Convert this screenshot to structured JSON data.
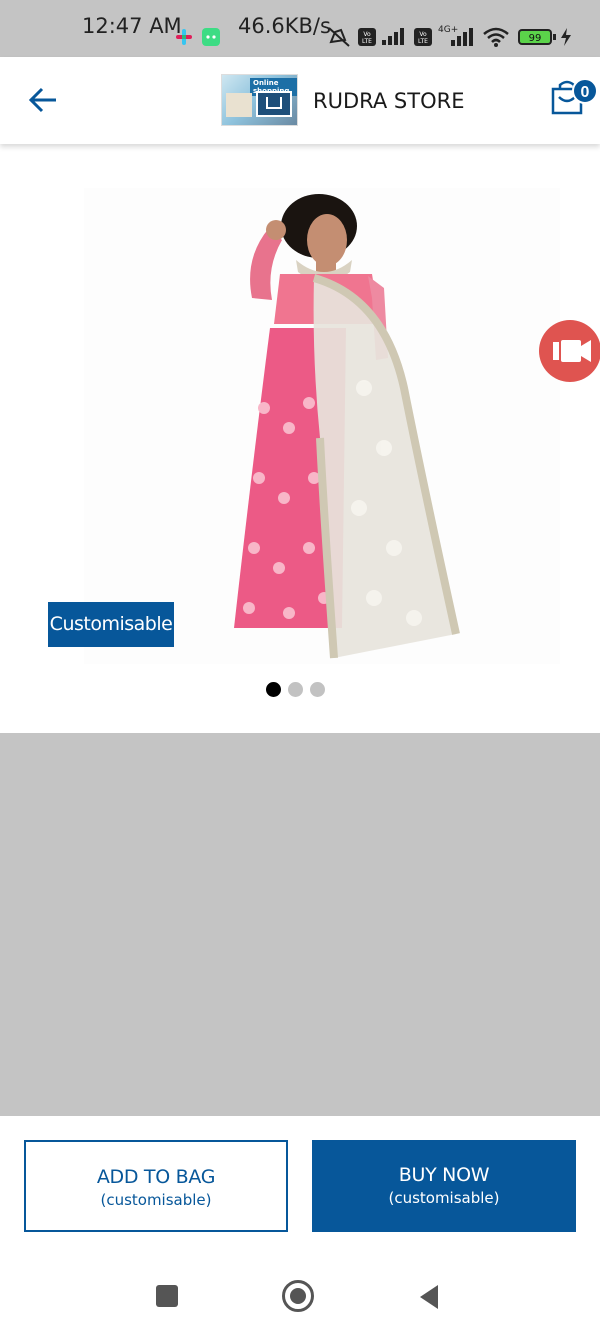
{
  "status_bar": {
    "time": "12:47 AM",
    "network_speed": "46.6KB/s",
    "battery": "99",
    "network_type": "4G+",
    "icons": [
      "slack-icon",
      "android-icon",
      "mute-icon",
      "volte-icon",
      "signal-icon",
      "volte-icon",
      "signal-icon",
      "wifi-icon",
      "battery-icon",
      "charging-icon"
    ]
  },
  "header": {
    "back_icon": "arrow-left-icon",
    "store_logo_text": "Online shopping",
    "store_name": "RUDRA STORE",
    "cart_icon": "shopping-bag-icon",
    "cart_count": "0"
  },
  "product": {
    "tag_label": "Customisable",
    "video_icon": "video-camera-icon",
    "image_count": 3,
    "active_image_index": 0
  },
  "actions": {
    "add_to_bag_label": "ADD TO BAG",
    "add_to_bag_sub": "(customisable)",
    "buy_now_label": "BUY NOW",
    "buy_now_sub": "(customisable)"
  },
  "nav": {
    "recents_icon": "square-icon",
    "home_icon": "circle-home-icon",
    "back_icon": "triangle-back-icon"
  },
  "colors": {
    "brand": "#07579a",
    "video_button": "#df5450",
    "placeholder_grey": "#c4c4c4"
  }
}
